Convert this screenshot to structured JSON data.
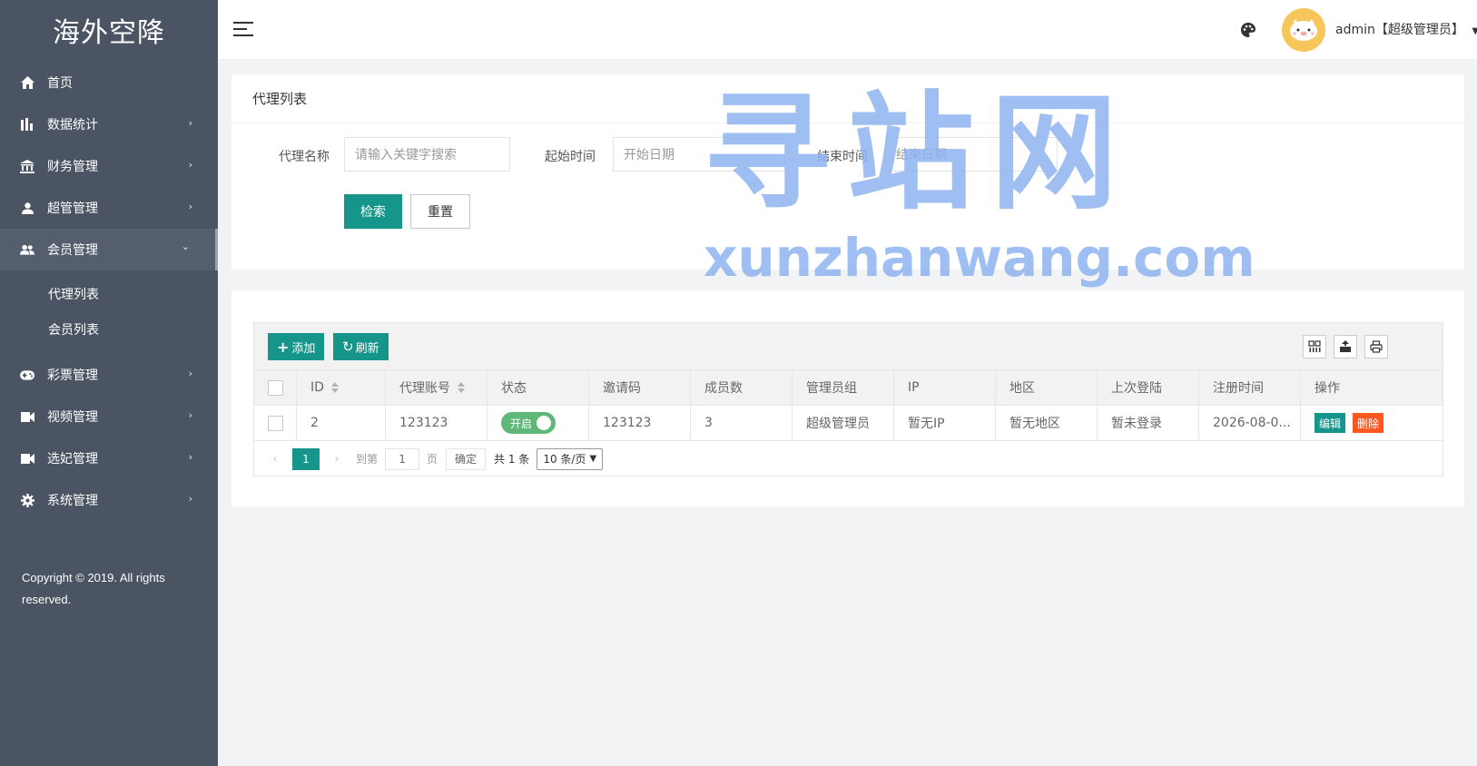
{
  "sidebar": {
    "brand": "海外空降",
    "items": [
      {
        "label": "首页",
        "icon": "home-icon"
      },
      {
        "label": "数据统计",
        "icon": "bar-chart-icon"
      },
      {
        "label": "财务管理",
        "icon": "bank-icon"
      },
      {
        "label": "超管管理",
        "icon": "user-icon"
      },
      {
        "label": "会员管理",
        "icon": "users-icon"
      },
      {
        "label": "彩票管理",
        "icon": "gamepad-icon"
      },
      {
        "label": "视频管理",
        "icon": "video-icon"
      },
      {
        "label": "选妃管理",
        "icon": "video-icon"
      },
      {
        "label": "系统管理",
        "icon": "gear-icon"
      }
    ],
    "sub_items": [
      {
        "label": "代理列表"
      },
      {
        "label": "会员列表"
      }
    ],
    "copyright": "Copyright © 2019. All rights reserved."
  },
  "header": {
    "user": "admin【超级管理员】"
  },
  "search": {
    "title": "代理列表",
    "name_label": "代理名称",
    "name_placeholder": "请输入关键字搜索",
    "start_label": "起始时间",
    "start_placeholder": "开始日期",
    "end_label": "结束时间",
    "end_placeholder": "结束日期",
    "search_button": "检索",
    "reset_button": "重置"
  },
  "table": {
    "add_button": "添加",
    "refresh_button": "刷新",
    "columns": [
      "ID",
      "代理账号",
      "状态",
      "邀请码",
      "成员数",
      "管理员组",
      "IP",
      "地区",
      "上次登陆",
      "注册时间",
      "操作"
    ],
    "rows": [
      {
        "id": "2",
        "account": "123123",
        "status": "开启",
        "invite": "123123",
        "members": "3",
        "group": "超级管理员",
        "ip": "暂无IP",
        "region": "暂无地区",
        "last_login": "暂未登录",
        "reg_time": "2026-08-0...",
        "edit": "编辑",
        "delete": "删除"
      }
    ]
  },
  "pager": {
    "current": "1",
    "goto_label": "到第",
    "goto_value": "1",
    "page_label": "页",
    "confirm": "确定",
    "total": "共 1 条",
    "per_page": "10 条/页"
  },
  "watermark": {
    "cn": "寻站网",
    "en": "xunzhanwang.com"
  },
  "colors": {
    "sidebar": "#4a5463",
    "primary": "#16968a",
    "switch_on": "#5fb878",
    "danger": "#ff5722",
    "watermark": "#8fb3f0"
  }
}
